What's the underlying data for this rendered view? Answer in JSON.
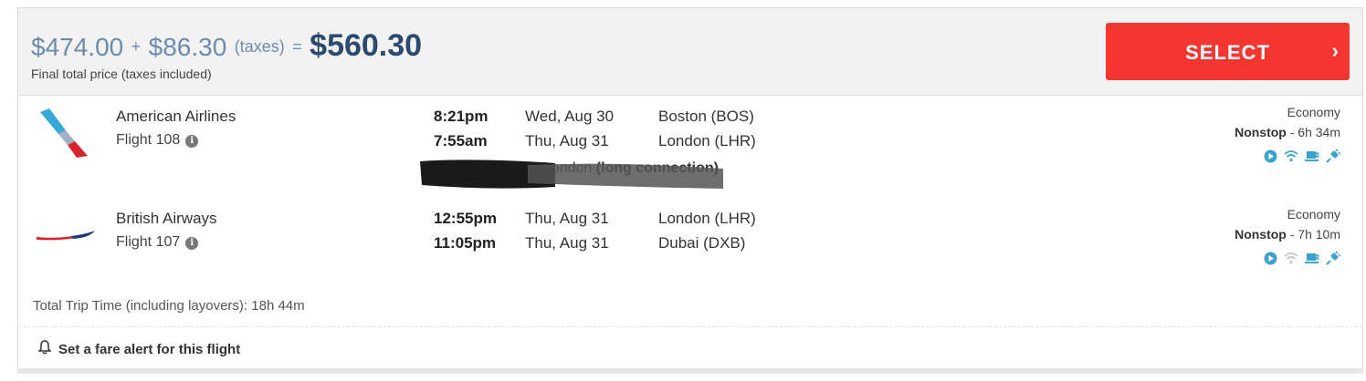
{
  "price": {
    "base": "$474.00",
    "plus": "+",
    "taxes": "$86.30",
    "taxes_label": "(taxes)",
    "equals": "=",
    "total": "$560.30",
    "note": "Final total price (taxes included)"
  },
  "select_button": {
    "label": "SELECT",
    "chevron": "›",
    "color": "#f43630"
  },
  "segments": [
    {
      "airline": "American Airlines",
      "flight": "Flight 108",
      "logo": "american-airlines-logo",
      "depart": {
        "time": "8:21pm",
        "date": "Wed, Aug 30",
        "place": "Boston (BOS)"
      },
      "arrive": {
        "time": "7:55am",
        "date": "Thu, Aug 31",
        "place": "London (LHR)"
      },
      "cabin": "Economy",
      "stops": "Nonstop",
      "duration": " - 6h 34m",
      "amenities": [
        "video-icon",
        "wifi-icon",
        "meal-icon",
        "power-icon"
      ]
    },
    {
      "airline": "British Airways",
      "flight": "Flight 107",
      "logo": "british-airways-logo",
      "depart": {
        "time": "12:55pm",
        "date": "Thu, Aug 31",
        "place": "London (LHR)"
      },
      "arrive": {
        "time": "11:05pm",
        "date": "Thu, Aug 31",
        "place": "Dubai (DXB)"
      },
      "cabin": "Economy",
      "stops": "Nonstop",
      "duration": " - 7h 10m",
      "amenities": [
        "video-icon",
        "wifi-icon",
        "meal-icon",
        "power-icon"
      ]
    }
  ],
  "layover": {
    "text_prefix": "in London ",
    "text_bold": "(long connection)"
  },
  "total_time": "Total Trip Time (including layovers): 18h 44m",
  "fare_alert": "Set a fare alert for this flight",
  "colors": {
    "accent": "#f43630",
    "price": "#6b8cae",
    "total": "#2c4a6e",
    "amenity": "#3ba3cc"
  }
}
